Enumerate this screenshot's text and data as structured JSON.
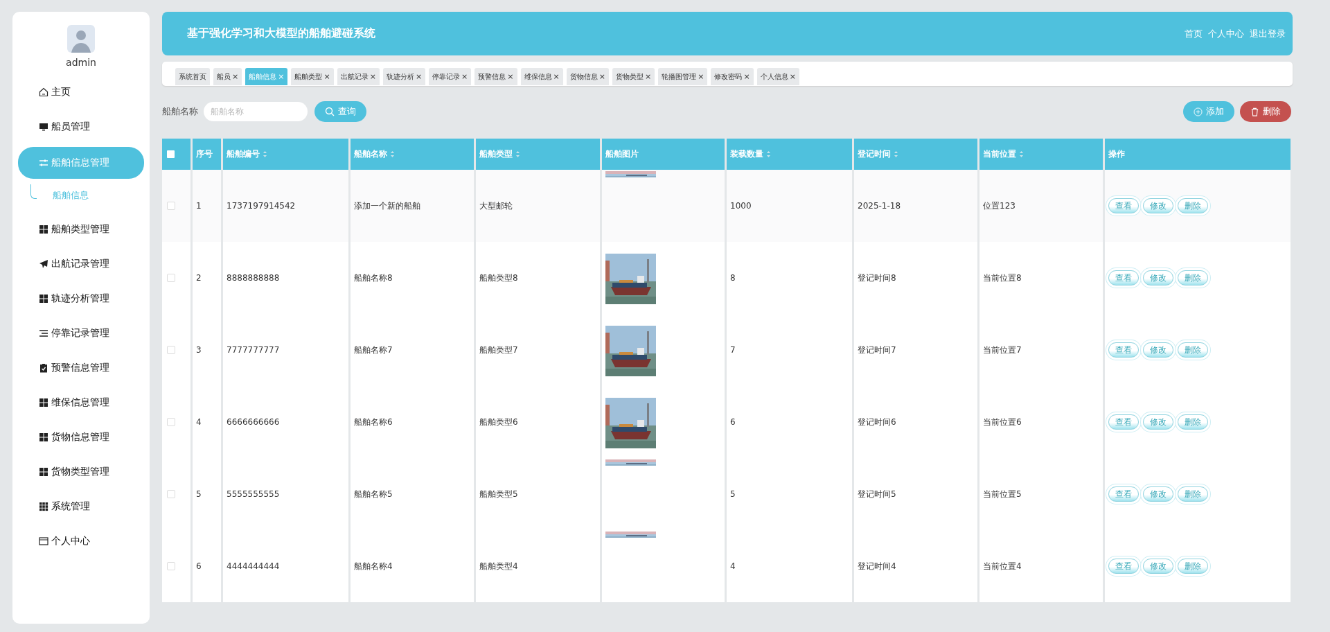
{
  "sidebar": {
    "user": "admin",
    "items": [
      {
        "label": "主页",
        "selected": false
      },
      {
        "label": "船员管理",
        "selected": false
      },
      {
        "label": "船舶信息管理",
        "selected": true,
        "expanded": true,
        "children": [
          {
            "label": "船舶信息",
            "selected": true
          }
        ]
      },
      {
        "label": "船舶类型管理",
        "selected": false
      },
      {
        "label": "出航记录管理",
        "selected": false
      },
      {
        "label": "轨迹分析管理",
        "selected": false
      },
      {
        "label": "停靠记录管理",
        "selected": false
      },
      {
        "label": "预警信息管理",
        "selected": false
      },
      {
        "label": "维保信息管理",
        "selected": false
      },
      {
        "label": "货物信息管理",
        "selected": false
      },
      {
        "label": "货物类型管理",
        "selected": false
      },
      {
        "label": "系统管理",
        "selected": false
      },
      {
        "label": "个人中心",
        "selected": false
      }
    ]
  },
  "header": {
    "title": "基于强化学习和大模型的船舶避碰系统",
    "links": [
      "首页",
      "个人中心",
      "退出登录"
    ]
  },
  "tabs": [
    {
      "label": "系统首页",
      "selected": false
    },
    {
      "label": "船员",
      "selected": false,
      "close": "×"
    },
    {
      "label": "船舶信息",
      "selected": true,
      "close": "×"
    },
    {
      "label": "船舶类型",
      "selected": false,
      "close": "×"
    },
    {
      "label": "出航记录",
      "selected": false,
      "close": "×"
    },
    {
      "label": "轨迹分析",
      "selected": false,
      "close": "×"
    },
    {
      "label": "停靠记录",
      "selected": false,
      "close": "×"
    },
    {
      "label": "预警信息",
      "selected": false,
      "close": "×"
    },
    {
      "label": "维保信息",
      "selected": false,
      "close": "×"
    },
    {
      "label": "货物信息",
      "selected": false,
      "close": "×"
    },
    {
      "label": "货物类型",
      "selected": false,
      "close": "×"
    },
    {
      "label": "轮播图管理",
      "selected": false,
      "close": "×"
    },
    {
      "label": "修改密码",
      "selected": false,
      "close": "×"
    },
    {
      "label": "个人信息",
      "selected": false,
      "close": "×"
    }
  ],
  "search": {
    "label": "船舶名称",
    "placeholder": "船舶名称",
    "button": "查询"
  },
  "actions": {
    "add": "添加",
    "delete": "删除"
  },
  "table": {
    "header_checked": false,
    "columns": [
      {
        "label": "序号",
        "sortable": false
      },
      {
        "label": "船舶编号",
        "sortable": true
      },
      {
        "label": "船舶名称",
        "sortable": true
      },
      {
        "label": "船舶类型",
        "sortable": true
      },
      {
        "label": "船舶图片",
        "sortable": false
      },
      {
        "label": "装载数量",
        "sortable": true
      },
      {
        "label": "登记时间",
        "sortable": true
      },
      {
        "label": "当前位置",
        "sortable": true
      },
      {
        "label": "操作",
        "sortable": false
      }
    ],
    "rows": [
      {
        "checked": false,
        "cells": [
          "1",
          "1737197914542",
          "添加一个新的船舶",
          "大型邮轮",
          {
            "kind": "strip-picture"
          },
          "1000",
          "2025-1-18",
          "位置123"
        ],
        "buttons": [
          "查看",
          "修改",
          "删除"
        ]
      },
      {
        "checked": false,
        "cells": [
          "2",
          "8888888888",
          "船舶名称8",
          "船舶类型8",
          {
            "kind": "picture"
          },
          "8",
          "登记时间8",
          "当前位置8"
        ],
        "buttons": [
          "查看",
          "修改",
          "删除"
        ]
      },
      {
        "checked": false,
        "cells": [
          "3",
          "7777777777",
          "船舶名称7",
          "船舶类型7",
          {
            "kind": "picture"
          },
          "7",
          "登记时间7",
          "当前位置7"
        ],
        "buttons": [
          "查看",
          "修改",
          "删除"
        ]
      },
      {
        "checked": false,
        "cells": [
          "4",
          "6666666666",
          "船舶名称6",
          "船舶类型6",
          {
            "kind": "picture"
          },
          "6",
          "登记时间6",
          "当前位置6"
        ],
        "buttons": [
          "查看",
          "修改",
          "删除"
        ]
      },
      {
        "checked": false,
        "cells": [
          "5",
          "5555555555",
          "船舶名称5",
          "船舶类型5",
          {
            "kind": "strip-picture"
          },
          "5",
          "登记时间5",
          "当前位置5"
        ],
        "buttons": [
          "查看",
          "修改",
          "删除"
        ]
      },
      {
        "checked": false,
        "cells": [
          "6",
          "4444444444",
          "船舶名称4",
          "船舶类型4",
          {
            "kind": "strip-picture"
          },
          "4",
          "登记时间4",
          "当前位置4"
        ],
        "buttons": [
          "查看",
          "修改",
          "删除"
        ]
      }
    ]
  }
}
